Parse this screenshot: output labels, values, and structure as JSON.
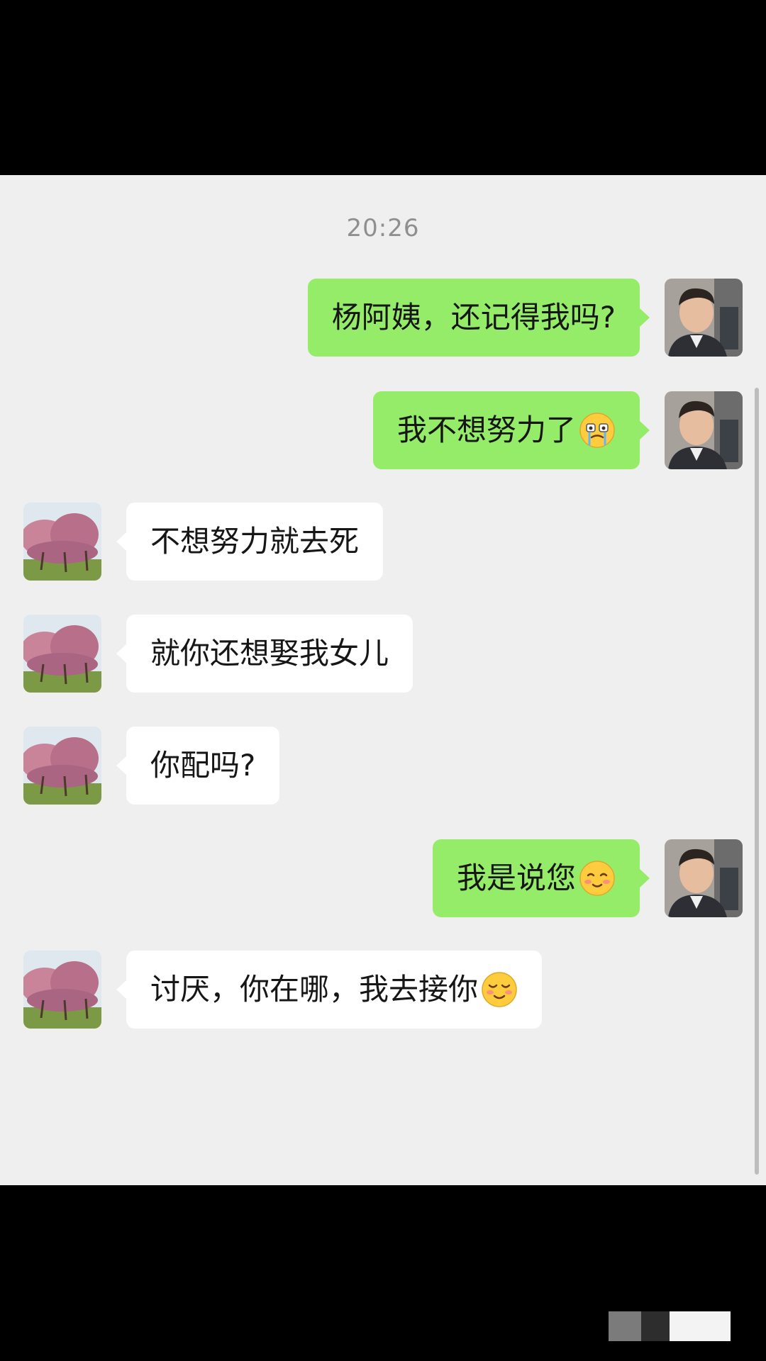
{
  "chat": {
    "timestamp": "20:26",
    "messages": [
      {
        "side": "right",
        "text": "杨阿姨，还记得我吗?",
        "emoji": ""
      },
      {
        "side": "right",
        "text": "我不想努力了",
        "emoji": "crying-mouth-emoji"
      },
      {
        "side": "left",
        "text": "不想努力就去死",
        "emoji": ""
      },
      {
        "side": "left",
        "text": "就你还想娶我女儿",
        "emoji": ""
      },
      {
        "side": "left",
        "text": "你配吗?",
        "emoji": ""
      },
      {
        "side": "right",
        "text": "我是说您",
        "emoji": "blushing-smile-emoji"
      },
      {
        "side": "left",
        "text": "讨厌，你在哪，我去接你",
        "emoji": "shy-smile-emoji"
      }
    ]
  },
  "colors": {
    "sent_bubble": "#95ec69",
    "received_bubble": "#ffffff",
    "chat_background": "#f0eff0"
  }
}
